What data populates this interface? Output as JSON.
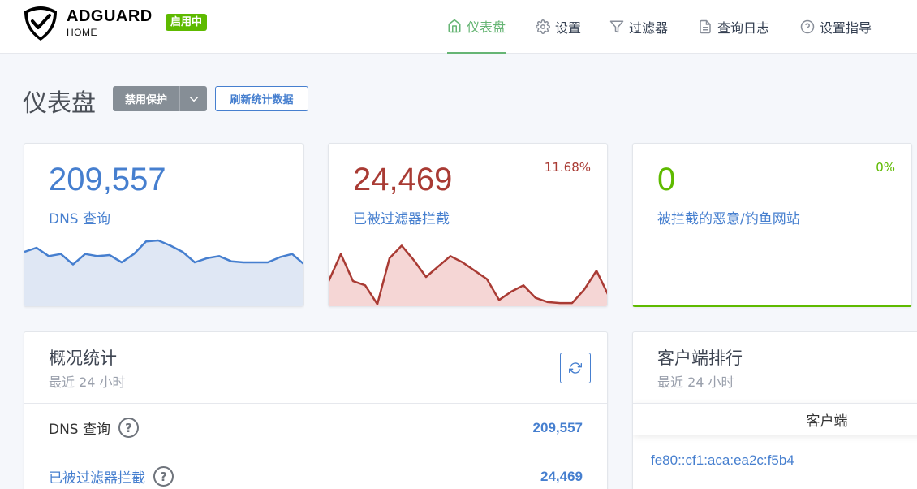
{
  "header": {
    "brand_name": "ADGUARD",
    "brand_sub": "HOME",
    "status_badge": "启用中",
    "nav": [
      {
        "label": "仪表盘",
        "icon": "home-icon",
        "active": true
      },
      {
        "label": "设置",
        "icon": "gear-icon",
        "active": false
      },
      {
        "label": "过滤器",
        "icon": "filter-icon",
        "active": false
      },
      {
        "label": "查询日志",
        "icon": "document-icon",
        "active": false
      },
      {
        "label": "设置指导",
        "icon": "help-circle-icon",
        "active": false
      }
    ]
  },
  "page": {
    "title": "仪表盘",
    "disable_button": "禁用保护",
    "refresh_stats_button": "刷新统计数据"
  },
  "stats": [
    {
      "value": "209,557",
      "label": "DNS 查询",
      "percent": "",
      "color": "#467fcf",
      "fill": "#dfe7f4",
      "spark": [
        52,
        56,
        48,
        50,
        40,
        50,
        48,
        49,
        42,
        50,
        62,
        63,
        58,
        52,
        42,
        46,
        48,
        43,
        42,
        42,
        42,
        47,
        50,
        40
      ]
    },
    {
      "value": "24,469",
      "label": "已被过滤器拦截",
      "percent": "11.68%",
      "color": "#a93b34",
      "fill": "#f5d6d5",
      "spark": [
        24,
        50,
        24,
        20,
        2,
        46,
        58,
        44,
        28,
        38,
        48,
        42,
        34,
        26,
        6,
        14,
        20,
        8,
        4,
        3,
        3,
        16,
        34,
        10
      ]
    },
    {
      "value": "0",
      "label": "被拦截的恶意/钓鱼网站",
      "percent": "0%",
      "color": "#5eba00",
      "fill": "#5eba00",
      "spark": []
    }
  ],
  "overview": {
    "title": "概况统计",
    "subtitle": "最近 24 小时",
    "rows": [
      {
        "label": "DNS 查询",
        "value": "209,557",
        "label_color": "#333",
        "value_color": "#467fcf"
      },
      {
        "label": "已被过滤器拦截",
        "value": "24,469",
        "label_color": "#467fcf",
        "value_color": "#467fcf"
      }
    ]
  },
  "clients": {
    "title": "客户端排行",
    "subtitle": "最近 24 小时",
    "column_header": "客户端",
    "items": [
      "fe80::cf1:aca:ea2c:f5b4"
    ]
  }
}
